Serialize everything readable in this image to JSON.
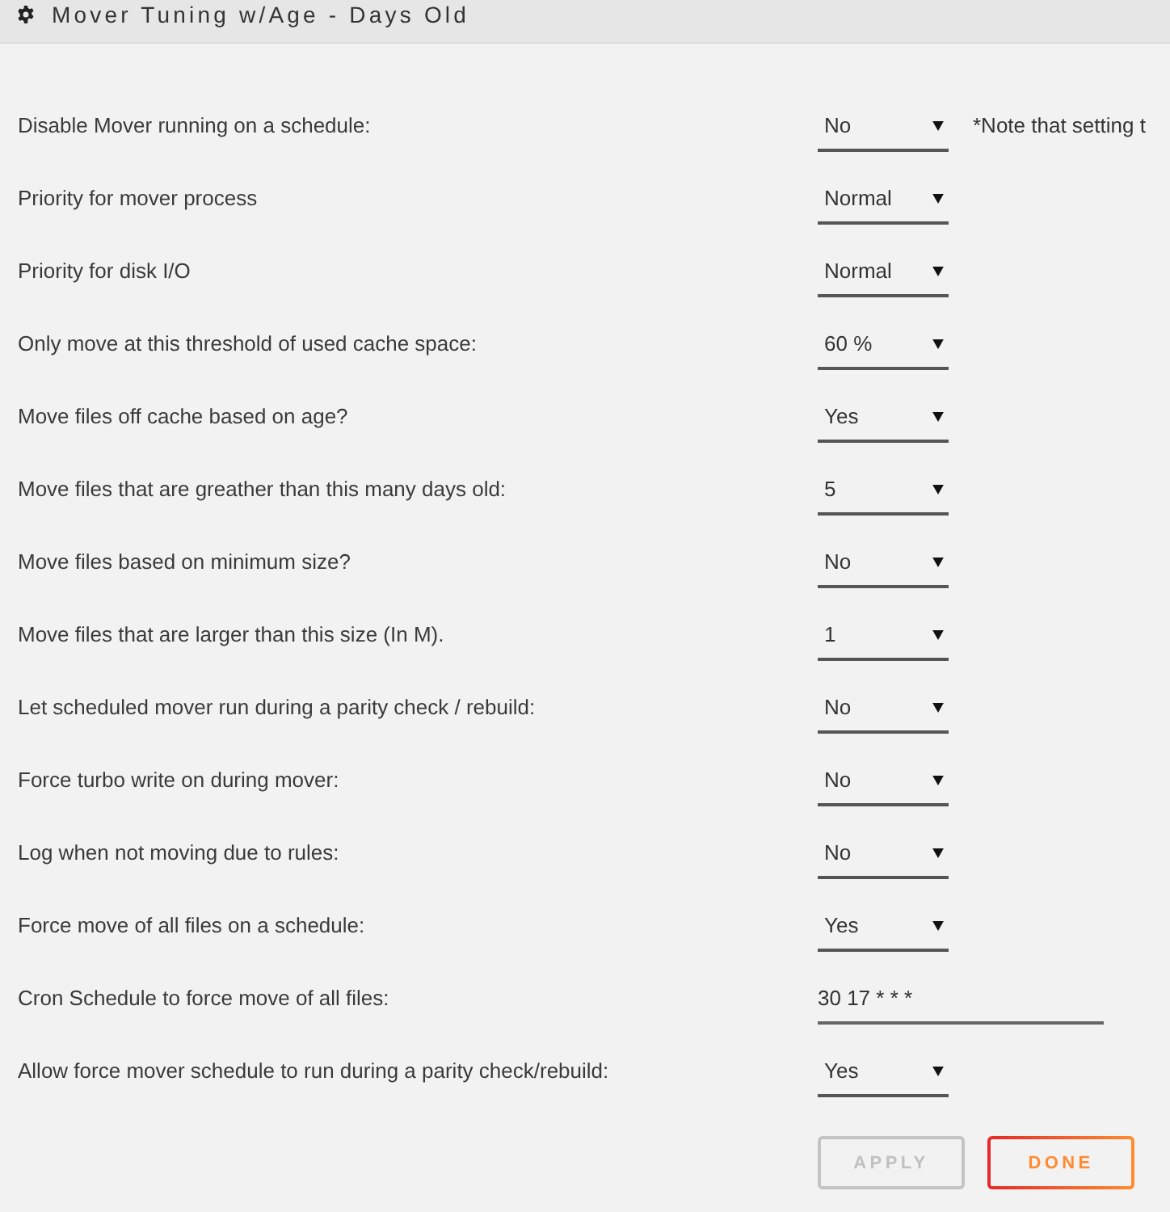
{
  "panel": {
    "title": "Mover Tuning w/Age - Days Old"
  },
  "settings": [
    {
      "kind": "select",
      "label": "Disable Mover running on a schedule:",
      "value": "No",
      "note": "*Note that setting t"
    },
    {
      "kind": "select",
      "label": "Priority for mover process",
      "value": "Normal"
    },
    {
      "kind": "select",
      "label": "Priority for disk I/O",
      "value": "Normal"
    },
    {
      "kind": "select",
      "label": "Only move at this threshold of used cache space:",
      "value": "60 %"
    },
    {
      "kind": "select",
      "label": "Move files off cache based on age?",
      "value": "Yes"
    },
    {
      "kind": "select",
      "label": "Move files that are greather than this many days old:",
      "value": "5"
    },
    {
      "kind": "select",
      "label": "Move files based on minimum size?",
      "value": "No"
    },
    {
      "kind": "select",
      "label": "Move files that are larger than this size (In M).",
      "value": "1"
    },
    {
      "kind": "select",
      "label": "Let scheduled mover run during a parity check / rebuild:",
      "value": "No"
    },
    {
      "kind": "select",
      "label": "Force turbo write on during mover:",
      "value": "No"
    },
    {
      "kind": "select",
      "label": "Log when not moving due to rules:",
      "value": "No"
    },
    {
      "kind": "select",
      "label": "Force move of all files on a schedule:",
      "value": "Yes"
    },
    {
      "kind": "text",
      "label": "Cron Schedule to force move of all files:",
      "value": "30 17 * * *"
    },
    {
      "kind": "select",
      "label": "Allow force mover schedule to run during a parity check/rebuild:",
      "value": "Yes"
    }
  ],
  "buttons": [
    {
      "label": "APPLY",
      "disabled": true
    },
    {
      "label": "DONE",
      "disabled": false
    }
  ]
}
